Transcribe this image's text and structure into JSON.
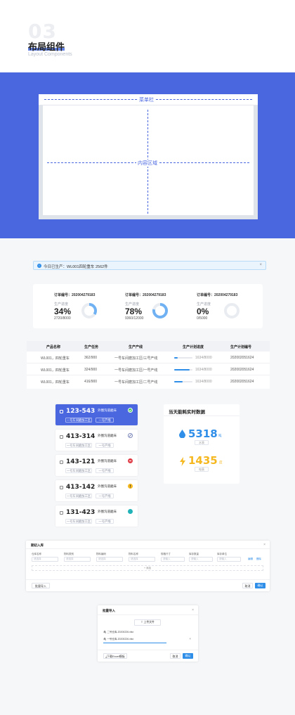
{
  "header": {
    "number": "03",
    "title": "布局组件",
    "subtitle": "Layout Components"
  },
  "layout_demo": {
    "menu_label": "菜单栏",
    "content_label": "内容区域"
  },
  "alert": {
    "text": "今日已生产：WL001四轮重车   2562件",
    "close": "×"
  },
  "orders": [
    {
      "no_label": "订单编号：202004279183",
      "progress_label": "生产进度",
      "percent": "34%",
      "count": "2720/8000",
      "value": 0.34
    },
    {
      "no_label": "订单编号：202004279183",
      "progress_label": "生产进度",
      "percent": "78%",
      "count": "9360/12000",
      "value": 0.78
    },
    {
      "no_label": "订单编号：202004279183",
      "progress_label": "生产进度",
      "percent": "0%",
      "count": "0/5000",
      "value": 0
    }
  ],
  "table": {
    "headers": [
      "产品名称",
      "生产任务",
      "生产产线",
      "生产计划进度",
      "生产计划编号"
    ],
    "rows": [
      {
        "name": "WL001，四轮重车",
        "task": "362/900",
        "line": "一号车间磨加工区/三号产线",
        "progress": "1634/8000",
        "value": 0.2,
        "code": "202002051624"
      },
      {
        "name": "WL001，四轮重车",
        "task": "324/900",
        "line": "一号车间磨加工区/一号产线",
        "progress": "1634/8000",
        "value": 0.85,
        "code": "202002051624"
      },
      {
        "name": "WL001，四轮重车",
        "task": "416/900",
        "line": "一号车间磨加工区/二号产线",
        "progress": "1634/8000",
        "value": 0.45,
        "code": "202002051624"
      }
    ]
  },
  "stations": [
    {
      "num": "123-543",
      "tag": "外圈沟道磨床",
      "pill1": "一号车间磨加工区",
      "pill2": "一号产线",
      "status_color": "#35c24a",
      "status_icon": "check-icon"
    },
    {
      "num": "413-314",
      "tag": "外圈沟道磨床",
      "pill1": "一号车间磨加工区",
      "pill2": "一号产线",
      "status_color": "#7a86b8",
      "status_icon": "ban-icon"
    },
    {
      "num": "143-121",
      "tag": "外圈沟道磨床",
      "pill1": "一号车间磨加工区",
      "pill2": "一号产线",
      "status_color": "#e0404a",
      "status_icon": "minus-icon"
    },
    {
      "num": "413-142",
      "tag": "外圈沟道磨床",
      "pill1": "一号车间磨加工区",
      "pill2": "一号产线",
      "status_color": "#f5b820",
      "status_icon": "alert-icon"
    },
    {
      "num": "131-423",
      "tag": "外圈沟道磨床",
      "pill1": "一号车间磨加工区",
      "pill2": "一号产线",
      "status_color": "#22b3b8",
      "status_icon": "dot-icon"
    }
  ],
  "energy": {
    "title": "当天能耗实时数据",
    "water": {
      "value": "5318",
      "unit": "吨",
      "label": "水表",
      "color": "#2f8ee8"
    },
    "power": {
      "value": "1435",
      "unit": "度",
      "label": "电表",
      "color": "#f5b820"
    }
  },
  "batch_dialog": {
    "title": "期初入库",
    "close": "×",
    "fields": [
      "仓库名称",
      "物料类别",
      "物料编码",
      "物料名称",
      "规格尺寸",
      "库存数量",
      "库存单位"
    ],
    "placeholders": [
      "请选择",
      "请选择",
      "请选择",
      "请选择",
      "请输入",
      "请输入",
      "请输入"
    ],
    "edit": "编辑",
    "delete": "删除",
    "add": "+ 添加",
    "import": "批量导入",
    "cancel": "取消",
    "ok": "确认"
  },
  "import_dialog": {
    "title": "批量导入",
    "close": "×",
    "upload": "上传文件",
    "file1": "二号仓库-20200226.xlsx",
    "file2": "一号仓库-20200226.xlsx",
    "file2_close": "×",
    "download": "下载Excel模板",
    "cancel": "取消",
    "ok": "确认"
  }
}
